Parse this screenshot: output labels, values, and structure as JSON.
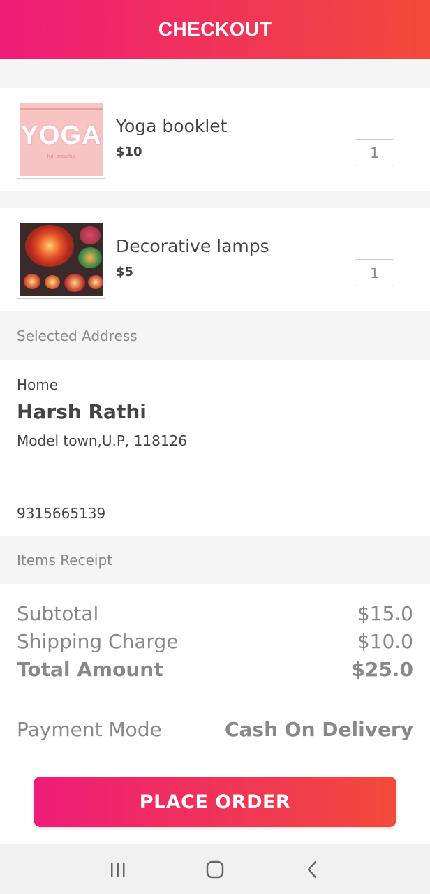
{
  "header": {
    "title": "CHECKOUT"
  },
  "products": [
    {
      "name": "Yoga booklet",
      "price": "$10",
      "qty": "1",
      "thumb_text": "YOGA",
      "thumb_sub": "full breathe"
    },
    {
      "name": "Decorative lamps",
      "price": "$5",
      "qty": "1"
    }
  ],
  "address_section": {
    "label": "Selected Address",
    "type": "Home",
    "name": "Harsh Rathi",
    "line": "Model town,U.P, 118126",
    "phone": "9315665139"
  },
  "receipt": {
    "label": "Items Receipt",
    "subtotal_label": "Subtotal",
    "subtotal_value": "$15.0",
    "shipping_label": "Shipping Charge",
    "shipping_value": "$10.0",
    "total_label": "Total Amount",
    "total_value": "$25.0",
    "payment_label": "Payment Mode",
    "payment_value": "Cash On Delivery"
  },
  "actions": {
    "place_order": "PLACE ORDER"
  },
  "navbar": {
    "icons": [
      "recent-apps-icon",
      "home-icon",
      "back-icon"
    ]
  },
  "colors": {
    "gradient_start": "#ee1c78",
    "gradient_end": "#f24a3a",
    "muted_text": "#888888",
    "primary_text": "#444444"
  }
}
